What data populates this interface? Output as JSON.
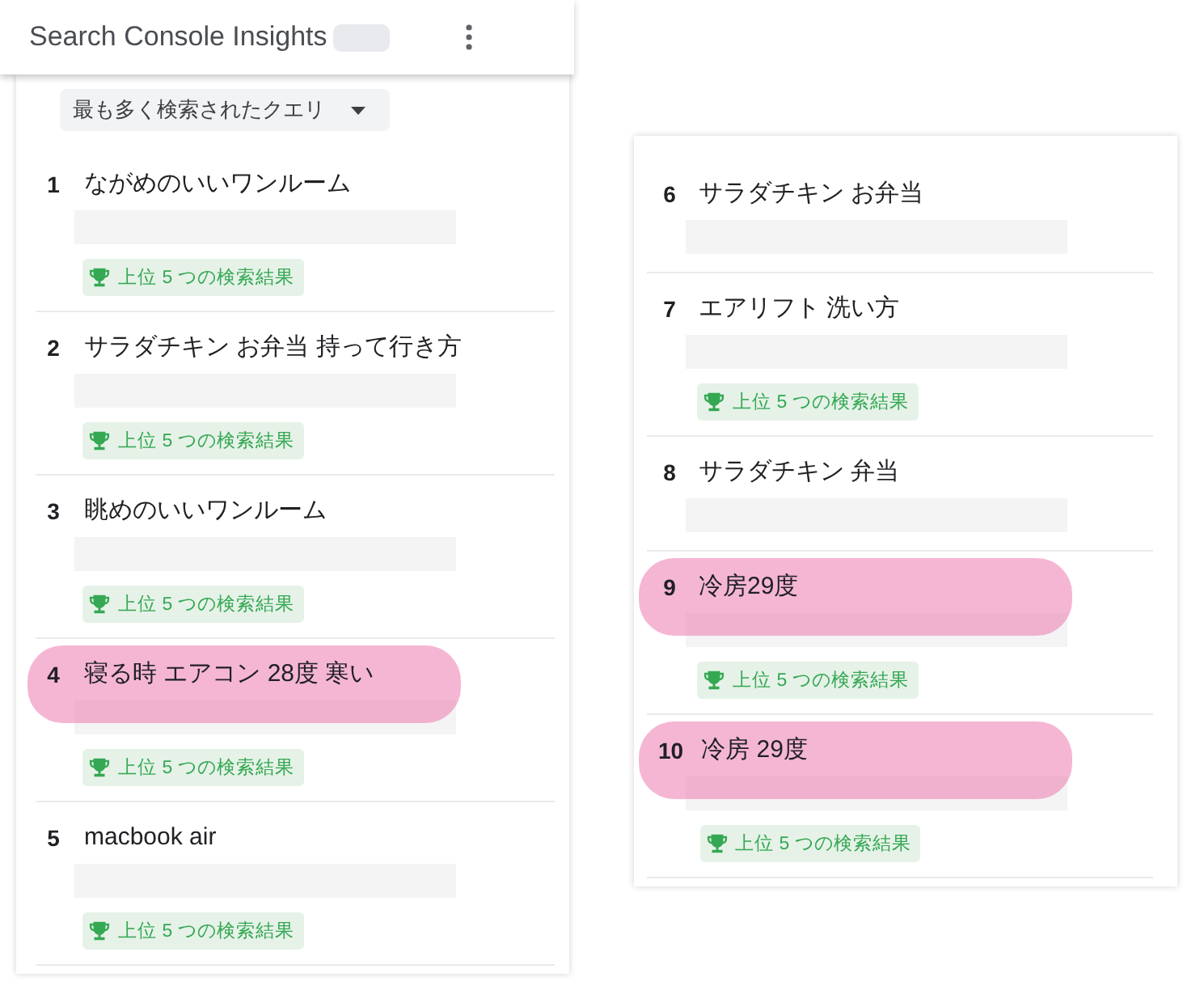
{
  "header": {
    "title": "Search Console Insights"
  },
  "left_card": {
    "dropdown": {
      "label": "最も多く検索されたクエリ"
    },
    "queries": [
      {
        "rank": "1",
        "text": "ながめのいいワンルーム",
        "highlighted": false,
        "badge": "上位 5 つの検索結果"
      },
      {
        "rank": "2",
        "text": "サラダチキン お弁当 持って行き方",
        "highlighted": false,
        "badge": "上位 5 つの検索結果"
      },
      {
        "rank": "3",
        "text": "眺めのいいワンルーム",
        "highlighted": false,
        "badge": "上位 5 つの検索結果"
      },
      {
        "rank": "4",
        "text": "寝る時 エアコン 28度 寒い",
        "highlighted": true,
        "badge": "上位 5 つの検索結果"
      },
      {
        "rank": "5",
        "text": "macbook air",
        "highlighted": false,
        "badge": "上位 5 つの検索結果"
      }
    ]
  },
  "right_card": {
    "queries": [
      {
        "rank": "6",
        "text": "サラダチキン お弁当",
        "highlighted": false
      },
      {
        "rank": "7",
        "text": "エアリフト 洗い方",
        "highlighted": false,
        "badge": "上位 5 つの検索結果"
      },
      {
        "rank": "8",
        "text": "サラダチキン 弁当",
        "highlighted": false
      },
      {
        "rank": "9",
        "text": "冷房29度",
        "highlighted": true,
        "badge": "上位 5 つの検索結果"
      },
      {
        "rank": "10",
        "text": "冷房 29度",
        "highlighted": true,
        "badge": "上位 5 つの検索結果"
      }
    ]
  }
}
